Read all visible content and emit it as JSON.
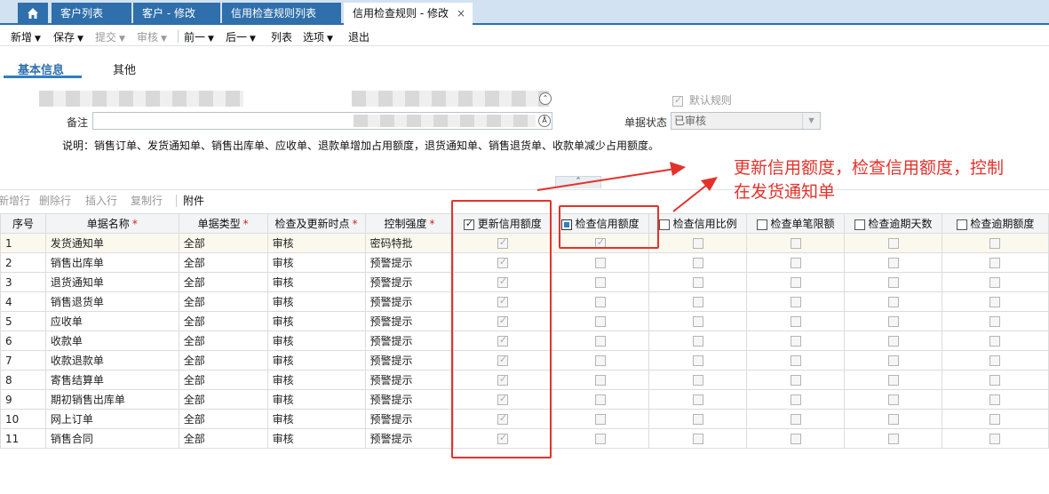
{
  "tabs": {
    "home_label": "",
    "items": [
      {
        "label": "客户列表",
        "active": false
      },
      {
        "label": "客户 - 修改",
        "active": false
      },
      {
        "label": "信用检查规则列表",
        "active": false
      },
      {
        "label": "信用检查规则 - 修改",
        "active": true
      }
    ],
    "close_glyph": "×"
  },
  "toolbar": {
    "items": [
      {
        "label": "新增",
        "caret": "▼",
        "disabled": false
      },
      {
        "label": "保存",
        "caret": "▼",
        "disabled": false
      },
      {
        "label": "提交",
        "caret": "▼",
        "disabled": true
      },
      {
        "label": "审核",
        "caret": "▼",
        "disabled": true
      },
      {
        "label": "前一",
        "caret": "▼",
        "disabled": false
      },
      {
        "label": "后一",
        "caret": "▼",
        "disabled": false
      },
      {
        "label": "列表",
        "caret": "",
        "disabled": false
      },
      {
        "label": "选项",
        "caret": "▼",
        "disabled": false
      },
      {
        "label": "退出",
        "caret": "",
        "disabled": false
      }
    ]
  },
  "subtabs": [
    "基本信息",
    "其他"
  ],
  "form": {
    "default_rule_label": "默认规则",
    "default_rule_checked": true,
    "remark_label": "备注",
    "remark_value": "",
    "status_label": "单据状态",
    "status_value": "已审核",
    "note": "说明：销售订单、发货通知单、销售出库单、应收单、退款单增加占用额度，退货通知单、销售退货单、收款单减少占用额度。"
  },
  "grid_toolbar": [
    {
      "label": "新增行",
      "enabled": false
    },
    {
      "label": "删除行",
      "enabled": false
    },
    {
      "label": "插入行",
      "enabled": false
    },
    {
      "label": "复制行",
      "enabled": false
    },
    {
      "label": "附件",
      "enabled": true
    }
  ],
  "grid": {
    "columns": [
      {
        "label": "序号",
        "required": false,
        "checkbox": false
      },
      {
        "label": "单据名称",
        "required": true,
        "checkbox": false
      },
      {
        "label": "单据类型",
        "required": true,
        "checkbox": false
      },
      {
        "label": "检查及更新时点",
        "required": true,
        "checkbox": false
      },
      {
        "label": "控制强度",
        "required": true,
        "checkbox": false
      },
      {
        "label": "更新信用额度",
        "required": false,
        "checkbox": true,
        "checked": true
      },
      {
        "label": "检查信用额度",
        "required": false,
        "checkbox": true,
        "checked": false,
        "focused": true
      },
      {
        "label": "检查信用比例",
        "required": false,
        "checkbox": true,
        "checked": false
      },
      {
        "label": "检查单笔限额",
        "required": false,
        "checkbox": true,
        "checked": false
      },
      {
        "label": "检查逾期天数",
        "required": false,
        "checkbox": true,
        "checked": false
      },
      {
        "label": "检查逾期额度",
        "required": false,
        "checkbox": true,
        "checked": false
      }
    ],
    "rows": [
      {
        "no": "1",
        "name": "发货通知单",
        "type": "全部",
        "timing": "审核",
        "strength": "密码特批",
        "update_credit": true,
        "check_credit": true
      },
      {
        "no": "2",
        "name": "销售出库单",
        "type": "全部",
        "timing": "审核",
        "strength": "预警提示",
        "update_credit": true,
        "check_credit": false
      },
      {
        "no": "3",
        "name": "退货通知单",
        "type": "全部",
        "timing": "审核",
        "strength": "预警提示",
        "update_credit": true,
        "check_credit": false
      },
      {
        "no": "4",
        "name": "销售退货单",
        "type": "全部",
        "timing": "审核",
        "strength": "预警提示",
        "update_credit": true,
        "check_credit": false
      },
      {
        "no": "5",
        "name": "应收单",
        "type": "全部",
        "timing": "审核",
        "strength": "预警提示",
        "update_credit": true,
        "check_credit": false
      },
      {
        "no": "6",
        "name": "收款单",
        "type": "全部",
        "timing": "审核",
        "strength": "预警提示",
        "update_credit": true,
        "check_credit": false
      },
      {
        "no": "7",
        "name": "收款退款单",
        "type": "全部",
        "timing": "审核",
        "strength": "预警提示",
        "update_credit": true,
        "check_credit": false
      },
      {
        "no": "8",
        "name": "寄售结算单",
        "type": "全部",
        "timing": "审核",
        "strength": "预警提示",
        "update_credit": true,
        "check_credit": false
      },
      {
        "no": "9",
        "name": "期初销售出库单",
        "type": "全部",
        "timing": "审核",
        "strength": "预警提示",
        "update_credit": true,
        "check_credit": false
      },
      {
        "no": "10",
        "name": "网上订单",
        "type": "全部",
        "timing": "审核",
        "strength": "预警提示",
        "update_credit": true,
        "check_credit": false
      },
      {
        "no": "11",
        "name": "销售合同",
        "type": "全部",
        "timing": "审核",
        "strength": "预警提示",
        "update_credit": true,
        "check_credit": false
      }
    ]
  },
  "annotation": {
    "line1": "更新信用额度，检查信用额度，控制",
    "line2": "在发货通知单",
    "color": "#e4322b"
  },
  "colors": {
    "accent": "#2f6fab",
    "tab_bar": "#d2e2f2"
  },
  "icons": {
    "home": "home-icon",
    "collapse": "chevron-up-icon"
  }
}
